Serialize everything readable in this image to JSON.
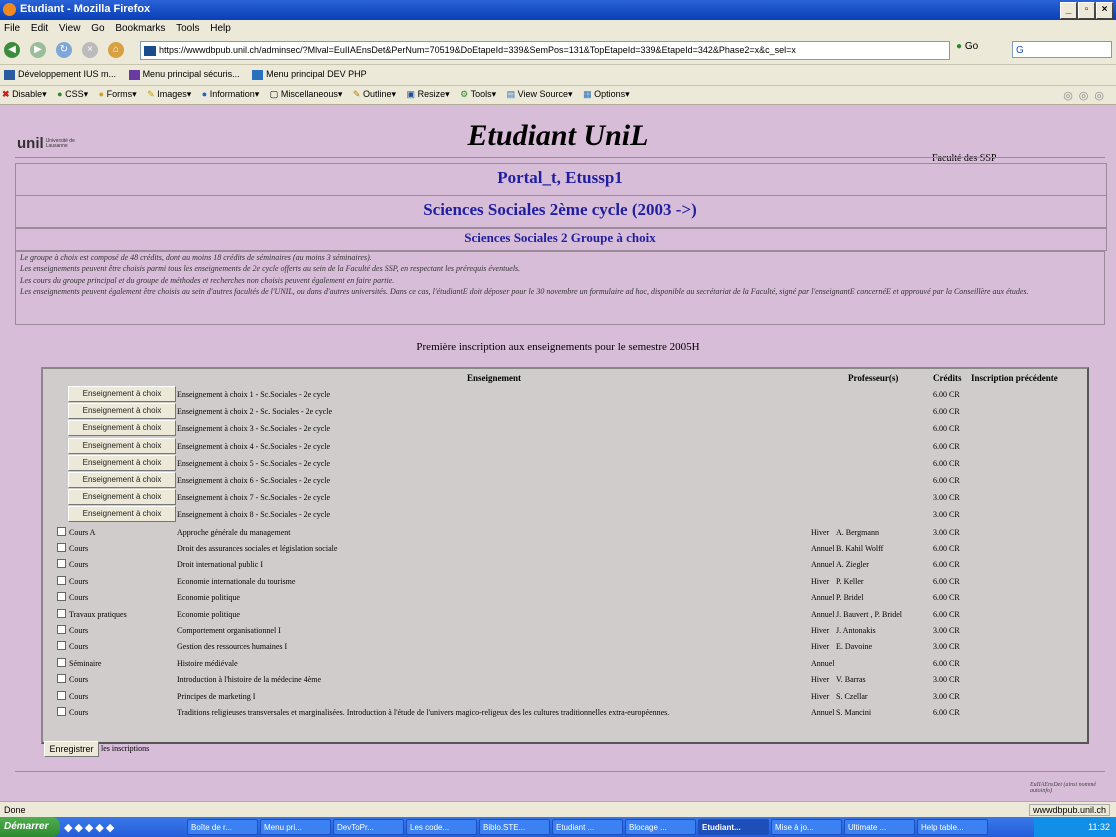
{
  "window": {
    "title": "Etudiant - Mozilla Firefox"
  },
  "menubar": [
    "File",
    "Edit",
    "View",
    "Go",
    "Bookmarks",
    "Tools",
    "Help"
  ],
  "urlbar": {
    "url": "https://wwwdbpub.unil.ch/adminsec/?Mlval=EuIIAEnsDet&PerNum=70519&DoEtapeId=339&SemPos=131&TopEtapeId=339&EtapeId=342&Phase2=x&c_sel=x",
    "go": "Go",
    "search_placeholder": "G"
  },
  "bookmarks": [
    "Développement IUS m...",
    "Menu principal sécuris...",
    "Menu principal DEV PHP"
  ],
  "devtoolbar": [
    "Disable",
    "CSS",
    "Forms",
    "Images",
    "Information",
    "Miscellaneous",
    "Outline",
    "Resize",
    "Tools",
    "View Source",
    "Options"
  ],
  "header": {
    "logo": "unil",
    "logo_sub": "Université de Lausanne",
    "title": "Etudiant UniL",
    "faculty": "Faculté des SSP"
  },
  "student": {
    "name": "Portal_t, Etussp1"
  },
  "program": {
    "title": "Sciences Sociales 2ème cycle (2003 ->)",
    "group": "Sciences Sociales 2 Groupe à choix"
  },
  "description": [
    "Le groupe à choix est composé de 48 crédits, dont au moins 18 crédits de séminaires (au moins 3 séminaires).",
    "Les enseignements peuvent être choisis parmi tous les enseignements de 2e cycle offerts au sein de la Faculté des SSP, en respectant les prérequis éventuels.",
    "Les cours du groupe principal et du groupe de méthodes et recherches non choisis peuvent également en faire partie.",
    "Les enseignements peuvent également être choisis au sein d'autres facultés de l'UNIL, ou dans d'autres universités. Dans ce cas, l'étudiantE doit déposer pour le 30 novembre un formulaire ad hoc, disponible au secrétariat de la Faculté, signé par l'enseignantE concernéE et approuvé par la Conseillère aux études."
  ],
  "first_inscription": "Première inscription aux enseignements pour le semestre 2005H",
  "table": {
    "headers": {
      "course": "Enseignement",
      "prof": "Professeur(s)",
      "credits": "Crédits",
      "previous": "Inscription précédente"
    },
    "choice_label": "Enseignement à choix",
    "choice_rows": [
      {
        "name": "Enseignement à choix 1 - Sc.Sociales - 2e cycle",
        "credits": "6.00 CR"
      },
      {
        "name": "Enseignement à choix 2 - Sc. Sociales - 2e cycle",
        "credits": "6.00 CR"
      },
      {
        "name": "Enseignement à choix 3 - Sc.Sociales - 2e cycle",
        "credits": "6.00 CR"
      },
      {
        "name": "Enseignement à choix 4 - Sc.Sociales - 2e cycle",
        "credits": "6.00 CR"
      },
      {
        "name": "Enseignement à choix 5 - Sc.Sociales - 2e cycle",
        "credits": "6.00 CR"
      },
      {
        "name": "Enseignement à choix 6 - Sc.Sociales - 2e cycle",
        "credits": "6.00 CR"
      },
      {
        "name": "Enseignement à choix 7 - Sc.Sociales - 2e cycle",
        "credits": "3.00 CR"
      },
      {
        "name": "Enseignement à choix 8 - Sc.Sociales - 2e cycle",
        "credits": "3.00 CR"
      }
    ],
    "course_rows": [
      {
        "type": "Cours A",
        "name": "Approche générale du management",
        "period": "Hiver",
        "prof": "A. Bergmann",
        "credits": "3.00 CR"
      },
      {
        "type": "Cours",
        "name": "Droit des assurances sociales et législation sociale",
        "period": "Annuel",
        "prof": "B. Kahil Wolff",
        "credits": "6.00 CR"
      },
      {
        "type": "Cours",
        "name": "Droit international public I",
        "period": "Annuel",
        "prof": "A. Ziegler",
        "credits": "6.00 CR"
      },
      {
        "type": "Cours",
        "name": "Economie internationale du tourisme",
        "period": "Hiver",
        "prof": "P. Keller",
        "credits": "6.00 CR"
      },
      {
        "type": "Cours",
        "name": "Economie politique",
        "period": "Annuel",
        "prof": "P. Bridel",
        "credits": "6.00 CR"
      },
      {
        "type": "Travaux pratiques",
        "name": "Economie politique",
        "period": "Annuel",
        "prof": "J. Bauvert , P. Bridel",
        "credits": "6.00 CR"
      },
      {
        "type": "Cours",
        "name": "Comportement organisationnel I",
        "period": "Hiver",
        "prof": "J. Antonakis",
        "credits": "3.00 CR"
      },
      {
        "type": "Cours",
        "name": "Gestion des ressources humaines I",
        "period": "Hiver",
        "prof": "E. Davoine",
        "credits": "3.00 CR"
      },
      {
        "type": "Séminaire",
        "name": "Histoire médiévale",
        "period": "Annuel",
        "prof": "",
        "credits": "6.00 CR"
      },
      {
        "type": "Cours",
        "name": "Introduction à l'histoire de la médecine 4ème",
        "period": "Hiver",
        "prof": "V. Barras",
        "credits": "3.00 CR"
      },
      {
        "type": "Cours",
        "name": "Principes de marketing I",
        "period": "Hiver",
        "prof": "S. Czellar",
        "credits": "3.00 CR"
      },
      {
        "type": "Cours",
        "name": "Traditions religieuses transversales et marginalisées. Introduction à l'étude de l'univers magico-religeux des les cultures traditionnelles extra-européennes.",
        "period": "Annuel",
        "prof": "S. Mancini",
        "credits": "6.00 CR"
      }
    ]
  },
  "save": {
    "button": "Enregistrer",
    "label": "les inscriptions"
  },
  "footer": "EuIIAEnsDet (ainsi nommé autoinfo)",
  "status": {
    "left": "Done",
    "right": "wwwdbpub.unil.ch"
  },
  "taskbar": {
    "start": "Démarrer",
    "tasks": [
      "Boîte de r...",
      "Menu pri...",
      "DevToPr...",
      "Les code...",
      "Biblo.STE...",
      "Etudiant ...",
      "Blocage ...",
      "Etudiant...",
      "Mise à jo...",
      "Ultimate ...",
      "Help table..."
    ],
    "clock": "11:32"
  },
  "colors": {
    "page_bg": "#d8bdd8",
    "heading": "#1f1fa0",
    "table_bg": "#d0cccc"
  }
}
